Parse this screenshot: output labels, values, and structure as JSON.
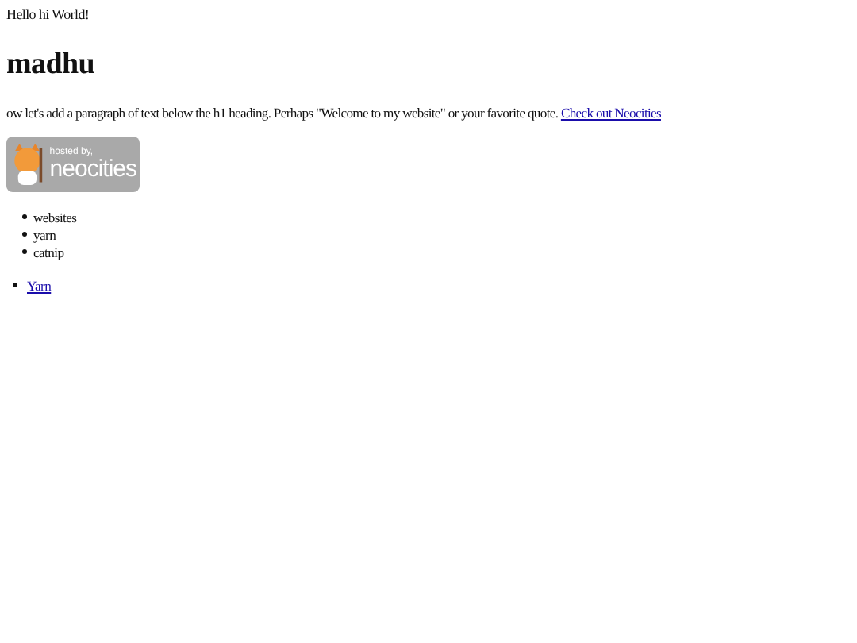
{
  "greeting": "Hello hi World!",
  "heading": "madhu",
  "paragraph": {
    "text": "ow let's add a paragraph of text below the h1 heading. Perhaps \"Welcome to my website\" or your favorite quote.",
    "link": "Check out Neocities"
  },
  "badge": {
    "line_1": "hosted by,",
    "line_2": "neocities"
  },
  "list": [
    "websites",
    "yarn",
    "catnip"
  ],
  "links": [
    "Yarn"
  ]
}
